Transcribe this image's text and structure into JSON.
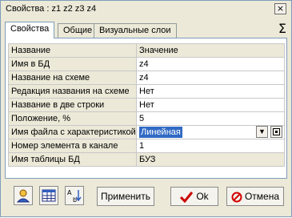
{
  "window": {
    "title": "Свойства :  z1  z2  z3  z4",
    "close_glyph": "×"
  },
  "tabs": [
    {
      "label": "Свойства",
      "active": true
    },
    {
      "label": "Общие",
      "active": false
    },
    {
      "label": "Визуальные слои",
      "active": false
    }
  ],
  "sigma_glyph": "Σ",
  "table": {
    "headers": [
      "Название",
      "Значение"
    ],
    "rows": [
      {
        "name": "Имя в БД",
        "value": "z4"
      },
      {
        "name": "Название на схеме",
        "value": "z4"
      },
      {
        "name": "Редакция названия на схеме",
        "value": "Нет"
      },
      {
        "name": "Название в две строки",
        "value": "Нет"
      },
      {
        "name": "Положение, %",
        "value": "5"
      },
      {
        "name": "Имя файла с характеристикой",
        "value": "Линейная"
      },
      {
        "name": "Номер элемента в канале",
        "value": "1"
      },
      {
        "name": "Имя таблицы БД",
        "value": "БУЗ"
      }
    ]
  },
  "buttons": {
    "apply": "Применить",
    "ok": "Ok",
    "cancel": "Отмена"
  },
  "colors": {
    "selection": "#316ac5",
    "ok_check": "#cc0000",
    "cancel_icon": "#d40000"
  }
}
